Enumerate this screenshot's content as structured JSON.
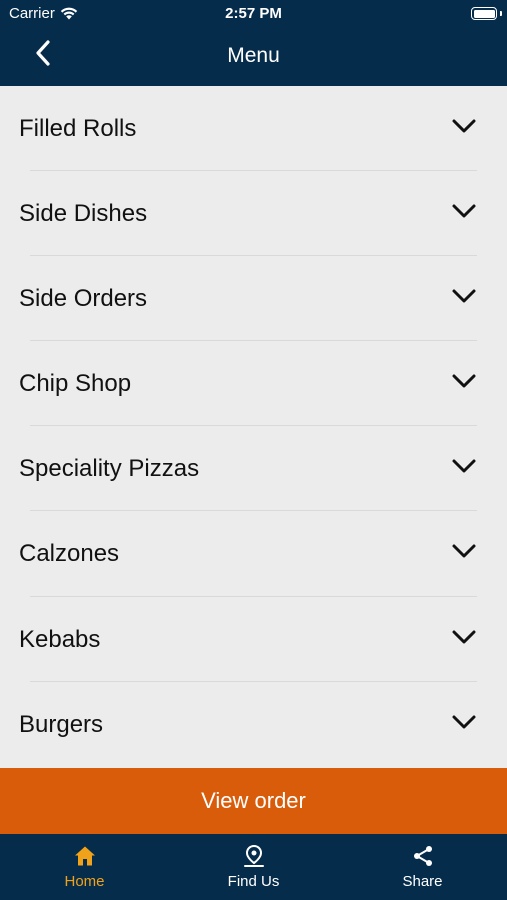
{
  "status_bar": {
    "carrier": "Carrier",
    "time": "2:57 PM"
  },
  "header": {
    "title": "Menu"
  },
  "menu": {
    "items": [
      {
        "label": "Filled Rolls"
      },
      {
        "label": "Side Dishes"
      },
      {
        "label": "Side Orders"
      },
      {
        "label": "Chip Shop"
      },
      {
        "label": "Speciality Pizzas"
      },
      {
        "label": "Calzones"
      },
      {
        "label": "Kebabs"
      },
      {
        "label": "Burgers"
      }
    ]
  },
  "view_order": {
    "label": "View order"
  },
  "tabs": [
    {
      "label": "Home",
      "icon": "home-icon",
      "active": true
    },
    {
      "label": "Find Us",
      "icon": "location-pin-icon",
      "active": false
    },
    {
      "label": "Share",
      "icon": "share-icon",
      "active": false
    }
  ],
  "colors": {
    "primary": "#062c4c",
    "accent": "#d95c0b",
    "active_tab": "#f0a21a"
  }
}
